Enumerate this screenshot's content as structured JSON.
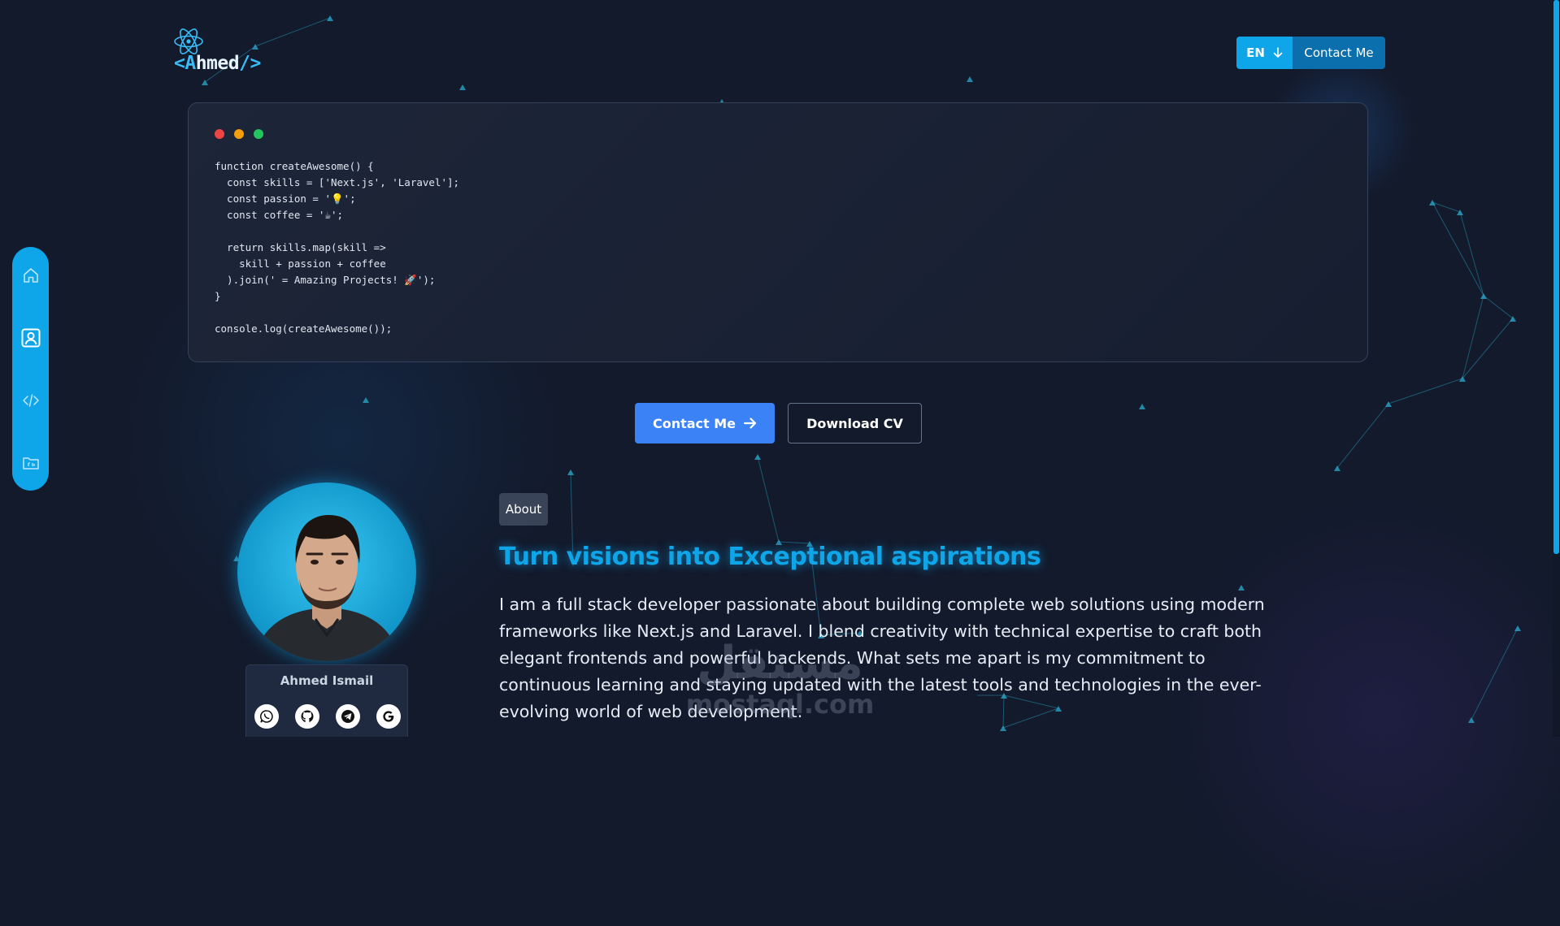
{
  "brand": {
    "logo_open": "<A",
    "logo_mid": "hmed",
    "logo_close": "/>",
    "logo_icon": "react-atom-icon"
  },
  "header": {
    "lang_label": "EN",
    "lang_icon": "arrow-down-icon",
    "contact_label": "Contact Me"
  },
  "code_window": {
    "dots": [
      "#ef4444",
      "#f59e0b",
      "#22c55e"
    ],
    "lines": [
      "function createAwesome() {",
      "  const skills = ['Next.js', 'Laravel'];",
      "  const passion = '💡';",
      "  const coffee = '☕';",
      "",
      "  return skills.map(skill =>",
      "    skill + passion + coffee",
      "  ).join(' = Amazing Projects! 🚀');",
      "}",
      "",
      "console.log(createAwesome());"
    ]
  },
  "side_nav": {
    "items": [
      {
        "name": "home",
        "icon": "home-icon"
      },
      {
        "name": "about",
        "icon": "user-card-icon"
      },
      {
        "name": "skills",
        "icon": "code-icon"
      },
      {
        "name": "projects",
        "icon": "folder-icon"
      }
    ]
  },
  "actions": {
    "primary_label": "Contact Me",
    "primary_icon": "arrow-right-icon",
    "secondary_label": "Download CV"
  },
  "profile": {
    "name": "Ahmed Ismail",
    "socials": [
      {
        "name": "whatsapp",
        "icon": "whatsapp-icon"
      },
      {
        "name": "github",
        "icon": "github-icon"
      },
      {
        "name": "telegram",
        "icon": "telegram-icon"
      },
      {
        "name": "google",
        "icon": "google-icon"
      }
    ]
  },
  "about": {
    "badge": "About",
    "headline": "Turn visions into Exceptional aspirations",
    "body": "I am a full stack developer passionate about building complete web solutions using modern frameworks like Next.js and Laravel. I blend creativity with technical expertise to craft both elegant frontends and powerful backends. What sets me apart is my commitment to continuous learning and staying updated with the latest tools and technologies in the ever-evolving world of web development."
  },
  "watermark": {
    "arabic": "مستقل",
    "latin": "mostaql.com"
  },
  "colors": {
    "background": "#131a2c",
    "accent": "#0ea5e9",
    "primary_button": "#3b82f6",
    "header_contact": "#0b6fae"
  }
}
